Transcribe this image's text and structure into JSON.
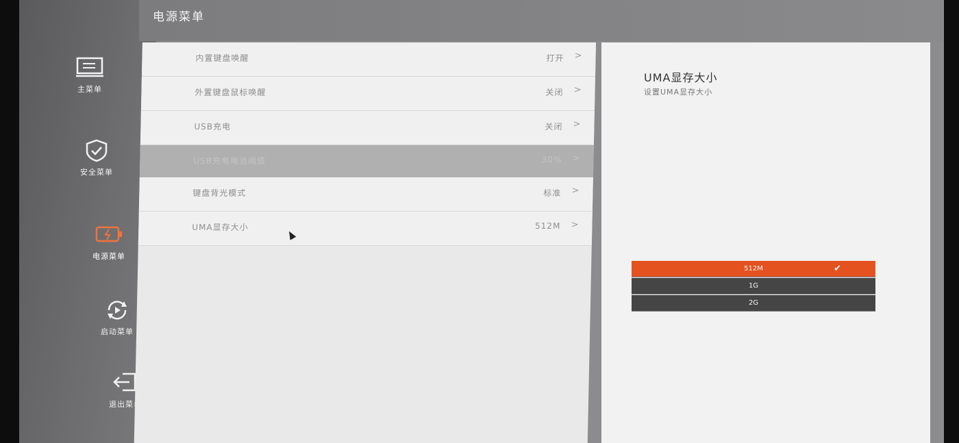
{
  "header": {
    "title": "电源菜单"
  },
  "sidebar": {
    "items": [
      {
        "label": "主菜单",
        "icon": "monitor-icon"
      },
      {
        "label": "安全菜单",
        "icon": "shield-check-icon"
      },
      {
        "label": "电源菜单",
        "icon": "battery-icon",
        "active": true
      },
      {
        "label": "启动菜单",
        "icon": "restart-icon"
      },
      {
        "label": "退出菜单",
        "icon": "exit-icon"
      }
    ]
  },
  "settings": [
    {
      "label": "内置键盘唤醒",
      "value": "打开"
    },
    {
      "label": "外置键盘鼠标唤醒",
      "value": "关闭"
    },
    {
      "label": "USB充电",
      "value": "关闭"
    },
    {
      "label": "USB充电电池阈值",
      "value": "30%"
    },
    {
      "label": "键盘背光模式",
      "value": "标准"
    },
    {
      "label": "UMA显存大小",
      "value": "512M"
    }
  ],
  "chevron": ">",
  "help": {
    "title": "UMA显存大小",
    "subtitle": "设置UMA显存大小"
  },
  "options": {
    "items": [
      "512M",
      "1G",
      "2G"
    ],
    "selected": "512M",
    "check": "✔"
  },
  "colors": {
    "accent": "#e4521f",
    "option_bg": "#454545"
  }
}
